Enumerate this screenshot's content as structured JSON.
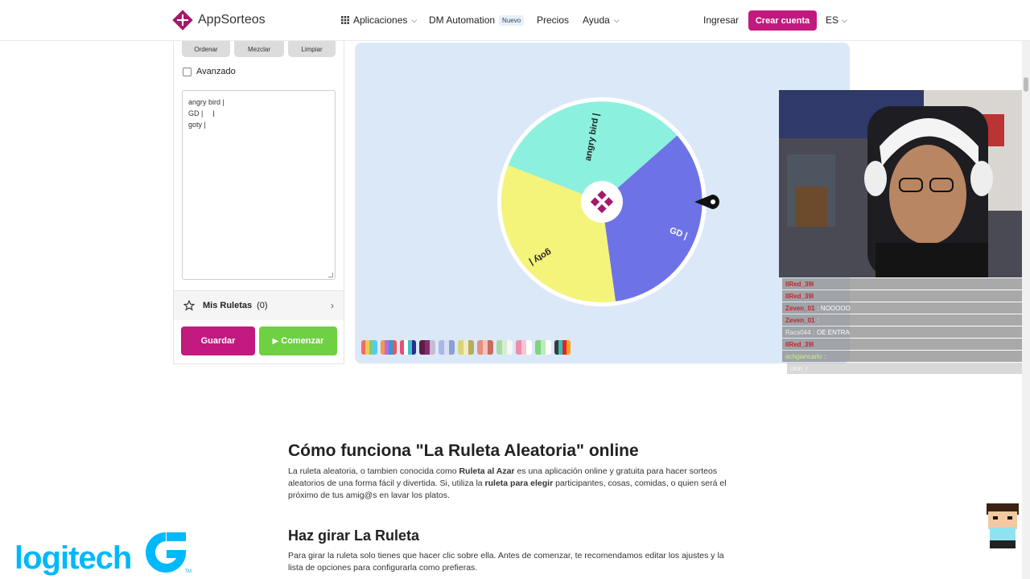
{
  "header": {
    "brand": "AppSorteos",
    "nav": [
      {
        "label": "Aplicaciones"
      },
      {
        "label": "DM Automation",
        "badge": "Nuevo"
      },
      {
        "label": "Precios"
      },
      {
        "label": "Ayuda"
      }
    ],
    "login": "Ingresar",
    "signup": "Crear cuenta",
    "lang": "ES"
  },
  "tools": {
    "sort": "Ordenar",
    "shuffle": "Mezclar",
    "clear": "Limpiar"
  },
  "advanced_label": "Avanzado",
  "entries": [
    "angry bird |",
    "GD |",
    "goty |"
  ],
  "my_wheels": {
    "label": "Mis Ruletas",
    "count": "(0)"
  },
  "actions": {
    "save": "Guardar",
    "start": "Comenzar"
  },
  "wheel": {
    "segments": [
      {
        "label": "angry bird |",
        "color": "#8cf0de"
      },
      {
        "label": "GD |",
        "color": "#6d73e6"
      },
      {
        "label": "goty |",
        "color": "#f4f37a"
      }
    ]
  },
  "chat": [
    {
      "user": "IIRed_39I",
      "msg": "",
      "style": "red"
    },
    {
      "user": "IIRed_39I",
      "msg": "",
      "style": "red"
    },
    {
      "user": "Zeven_01",
      "msg": ": NOOOOO",
      "style": "red"
    },
    {
      "user": "Zeven_01",
      "msg": ":",
      "style": "red"
    },
    {
      "user": "Racs044",
      "msg": ": OE ENTRA",
      "style": "white"
    },
    {
      "user": "IIRed_39I",
      "msg": "",
      "style": "red"
    },
    {
      "user": "achgiancarlo",
      "msg": ":",
      "style": "green"
    },
    {
      "user": "olon_r",
      "msg": "",
      "style": "white"
    }
  ],
  "article": {
    "h1": "Cómo funciona \"La Ruleta Aleatoria\" online",
    "p1_a": "La ruleta aleatoria, o tambien conocida como ",
    "p1_b": "Ruleta al Azar",
    "p1_c": " es una aplicación online y gratuita para hacer sorteos aleatorios de una forma fácil y divertida. Si, utiliza la ",
    "p1_d": "ruleta para elegir",
    "p1_e": " participantes, cosas, comidas, o quien será el próximo de tus amig@s en lavar los platos.",
    "h2": "Haz girar La Ruleta",
    "p2": "Para girar la ruleta solo tienes que hacer clic sobre ella. Antes de comenzar, te recomendamos editar los ajustes y la lista de opciones para configurarla como prefieras."
  },
  "overlay": {
    "sponsor": "logitech",
    "tm": "TM"
  }
}
